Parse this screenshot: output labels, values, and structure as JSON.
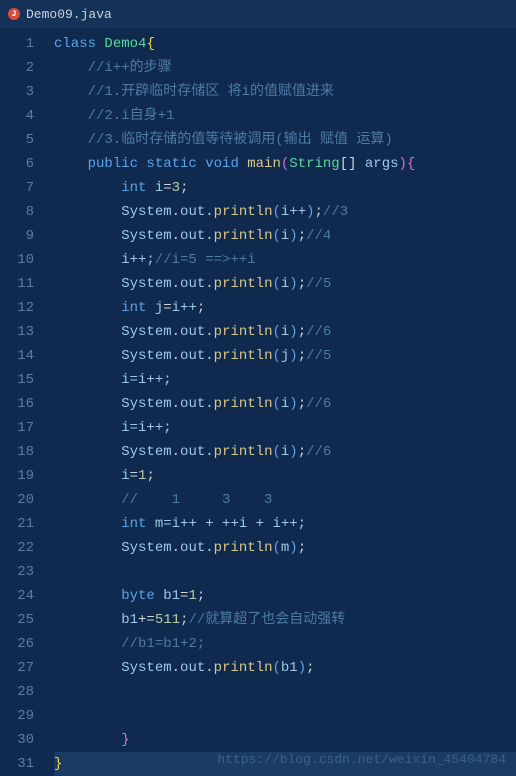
{
  "tab": {
    "filename": "Demo09.java",
    "icon_letter": "J"
  },
  "line_count": 31,
  "code": {
    "l1": {
      "kw": "class",
      "name": "Demo4",
      "brace": "{"
    },
    "l2": {
      "comment": "//i++的步骤"
    },
    "l3": {
      "comment": "//1.开辟临时存储区 将i的值赋值进来"
    },
    "l4": {
      "comment": "//2.i自身+1"
    },
    "l5": {
      "comment": "//3.临时存储的值等待被调用(输出 赋值 运算)"
    },
    "l6": {
      "mods": "public static",
      "ret": "void",
      "name": "main",
      "param_type": "String",
      "param_name": "args",
      "brace": "{"
    },
    "l7": {
      "type": "int",
      "var": "i",
      "op": "=",
      "val": "3",
      "semi": ";"
    },
    "l8": {
      "sys": "System",
      "out": "out",
      "method": "println",
      "arg": "i++",
      "comment": "//3"
    },
    "l9": {
      "sys": "System",
      "out": "out",
      "method": "println",
      "arg": "i",
      "comment": "//4"
    },
    "l10": {
      "stmt": "i++;",
      "comment": "//i=5 ==>++i"
    },
    "l11": {
      "sys": "System",
      "out": "out",
      "method": "println",
      "arg": "i",
      "comment": "//5"
    },
    "l12": {
      "type": "int",
      "var": "j",
      "op": "=",
      "rhs": "i++",
      "semi": ";"
    },
    "l13": {
      "sys": "System",
      "out": "out",
      "method": "println",
      "arg": "i",
      "comment": "//6"
    },
    "l14": {
      "sys": "System",
      "out": "out",
      "method": "println",
      "arg": "j",
      "comment": "//5"
    },
    "l15": {
      "stmt": "i=i++;"
    },
    "l16": {
      "sys": "System",
      "out": "out",
      "method": "println",
      "arg": "i",
      "comment": "//6"
    },
    "l17": {
      "stmt": "i=i++;"
    },
    "l18": {
      "sys": "System",
      "out": "out",
      "method": "println",
      "arg": "i",
      "comment": "//6"
    },
    "l19": {
      "lhs": "i",
      "op": "=",
      "val": "1",
      "semi": ";"
    },
    "l20": {
      "comment": "//    1     3    3"
    },
    "l21": {
      "type": "int",
      "var": "m",
      "rhs": "=i++ + ++i + i++;"
    },
    "l22": {
      "sys": "System",
      "out": "out",
      "method": "println",
      "arg": "m"
    },
    "l24": {
      "type": "byte",
      "var": "b1",
      "op": "=",
      "val": "1",
      "semi": ";"
    },
    "l25": {
      "lhs": "b1",
      "op": "+=",
      "val": "511",
      "semi": ";",
      "comment": "//就算超了也会自动强转"
    },
    "l26": {
      "comment": "//b1=b1+2;"
    },
    "l27": {
      "sys": "System",
      "out": "out",
      "method": "println",
      "arg": "b1"
    },
    "l30": {
      "brace": "}"
    },
    "l31": {
      "brace": "}"
    }
  },
  "watermark": "https://blog.csdn.net/weixin_45404784"
}
